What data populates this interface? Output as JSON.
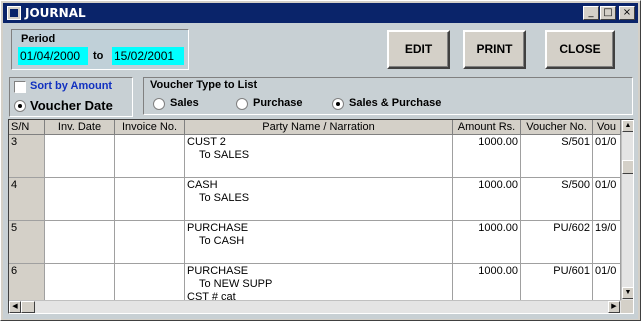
{
  "window": {
    "title": "JOURNAL",
    "min_label": "_",
    "max_label": "□",
    "close_label": "×"
  },
  "period": {
    "label": "Period",
    "from": "01/04/2000",
    "to_label": "to",
    "to": "15/02/2001"
  },
  "buttons": {
    "edit": "EDIT",
    "print": "PRINT",
    "close": "CLOSE"
  },
  "options": {
    "sort_by_amount": "Sort by Amount",
    "sort_checked": false,
    "voucher_date": "Voucher Date",
    "voucher_date_selected": true
  },
  "voucher_type": {
    "title": "Voucher Type to List",
    "options": [
      "Sales",
      "Purchase",
      "Sales & Purchase"
    ],
    "selected": "Sales & Purchase"
  },
  "grid": {
    "columns": [
      "S/N",
      "Inv. Date",
      "Invoice No.",
      "Party Name / Narration",
      "Amount Rs.",
      "Voucher No.",
      "Vou"
    ],
    "rows": [
      {
        "sn": "3",
        "inv_date": "",
        "invoice_no": "",
        "party": "CUST 2",
        "narration": "To SALES",
        "extra": "",
        "amount": "1000.00",
        "voucher_no": "S/501",
        "vou": "01/0"
      },
      {
        "sn": "4",
        "inv_date": "",
        "invoice_no": "",
        "party": "CASH",
        "narration": "To SALES",
        "extra": "",
        "amount": "1000.00",
        "voucher_no": "S/500",
        "vou": "01/0"
      },
      {
        "sn": "5",
        "inv_date": "",
        "invoice_no": "",
        "party": "PURCHASE",
        "narration": "To CASH",
        "extra": "",
        "amount": "1000.00",
        "voucher_no": "PU/602",
        "vou": "19/0"
      },
      {
        "sn": "6",
        "inv_date": "",
        "invoice_no": "",
        "party": "PURCHASE",
        "narration": "To NEW SUPP",
        "extra": "CST # cat",
        "amount": "1000.00",
        "voucher_no": "PU/601",
        "vou": "01/0"
      }
    ]
  },
  "scrollbar": {
    "up": "▲",
    "down": "▼",
    "left": "◀",
    "right": "▶"
  }
}
